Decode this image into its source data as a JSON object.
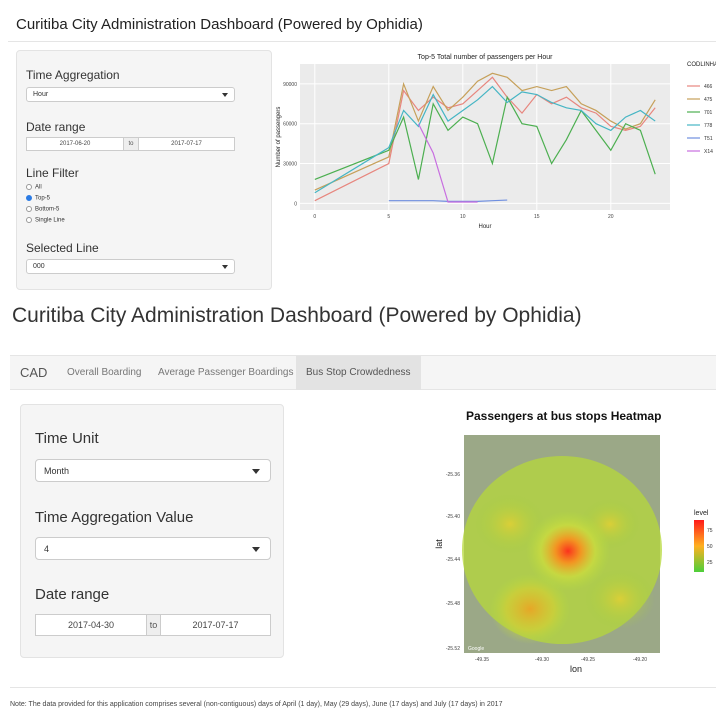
{
  "top_dashboard": {
    "title": "Curitiba City Administration Dashboard (Powered by Ophidia)",
    "time_aggregation": {
      "label": "Time Aggregation",
      "value": "Hour"
    },
    "date_range": {
      "label": "Date range",
      "start": "2017-06-20",
      "separator": "to",
      "end": "2017-07-17"
    },
    "line_filter": {
      "label": "Line Filter",
      "options": [
        "All",
        "Top-5",
        "Bottom-5",
        "Single Line"
      ],
      "selected": "Top-5"
    },
    "selected_line": {
      "label": "Selected Line",
      "value": "000"
    }
  },
  "chart_data": {
    "type": "line",
    "title": "Top-5 Total number of passengers per Hour",
    "xlabel": "Hour",
    "ylabel": "Number of passengers",
    "xlim": [
      -1,
      24
    ],
    "ylim": [
      -5000,
      105000
    ],
    "x_ticks": [
      0,
      5,
      10,
      15,
      20
    ],
    "y_ticks": [
      0,
      30000,
      60000,
      90000
    ],
    "y_tick_labels": [
      "0",
      "30000",
      "60000",
      "90000"
    ],
    "legend_title": "CODLINHA",
    "legend_position": "right",
    "background": "grey",
    "series": [
      {
        "name": "466",
        "color": "#e7867e",
        "x": [
          0,
          5,
          6,
          7,
          8,
          9,
          10,
          11,
          12,
          13,
          14,
          15,
          16,
          17,
          18,
          19,
          20,
          21,
          22,
          23
        ],
        "y": [
          2000,
          30000,
          85000,
          70000,
          80000,
          72000,
          75000,
          85000,
          95000,
          80000,
          68000,
          82000,
          75000,
          80000,
          72000,
          68000,
          58000,
          55000,
          58000,
          72000
        ]
      },
      {
        "name": "475",
        "color": "#c6a05a",
        "x": [
          0,
          5,
          6,
          7,
          8,
          9,
          10,
          11,
          12,
          13,
          14,
          15,
          16,
          17,
          18,
          19,
          20,
          21,
          22,
          23
        ],
        "y": [
          10000,
          35000,
          90000,
          62000,
          88000,
          70000,
          80000,
          92000,
          98000,
          95000,
          85000,
          88000,
          85000,
          88000,
          75000,
          70000,
          62000,
          56000,
          60000,
          78000
        ]
      },
      {
        "name": "701",
        "color": "#4caf50",
        "x": [
          0,
          5,
          6,
          7,
          8,
          9,
          10,
          11,
          12,
          13,
          14,
          15,
          16,
          17,
          18,
          19,
          20,
          21,
          22,
          23
        ],
        "y": [
          18000,
          40000,
          65000,
          18000,
          75000,
          55000,
          65000,
          60000,
          30000,
          80000,
          60000,
          58000,
          30000,
          48000,
          70000,
          55000,
          40000,
          60000,
          55000,
          22000
        ]
      },
      {
        "name": "778",
        "color": "#45b5c4",
        "x": [
          0,
          5,
          6,
          7,
          8,
          9,
          10,
          11,
          12,
          13,
          14,
          15,
          16,
          17,
          18,
          19,
          20,
          21,
          22,
          23
        ],
        "y": [
          8000,
          42000,
          70000,
          58000,
          82000,
          62000,
          70000,
          78000,
          88000,
          76000,
          84000,
          82000,
          76000,
          72000,
          70000,
          60000,
          55000,
          65000,
          70000,
          62000
        ]
      },
      {
        "name": "T51",
        "color": "#6f8fe0",
        "x": [
          5,
          6,
          7,
          8,
          9,
          10,
          11,
          12,
          13
        ],
        "y": [
          2000,
          2000,
          2000,
          2000,
          1500,
          1500,
          1500,
          2000,
          2500
        ]
      },
      {
        "name": "X14",
        "color": "#c86ee0",
        "x": [
          7,
          8,
          9,
          10,
          11
        ],
        "y": [
          60000,
          38000,
          1000,
          1000,
          1000
        ]
      }
    ]
  },
  "bottom_dashboard": {
    "title": "Curitiba City Administration Dashboard (Powered by Ophidia)",
    "tabs": [
      "CAD",
      "Overall Boarding",
      "Average Passenger Boardings",
      "Bus Stop Crowdedness"
    ],
    "active_tab": "Bus Stop Crowdedness",
    "time_unit": {
      "label": "Time Unit",
      "value": "Month"
    },
    "time_aggregation_value": {
      "label": "Time Aggregation Value",
      "value": "4"
    },
    "date_range": {
      "label": "Date range",
      "start": "2017-04-30",
      "separator": "to",
      "end": "2017-07-17"
    }
  },
  "heatmap": {
    "title": "Passengers at bus stops Heatmap",
    "xlabel": "lon",
    "ylabel": "lat",
    "x_tick_labels": [
      "-49.35",
      "-49.30",
      "-49.25",
      "-49.20"
    ],
    "y_tick_labels": [
      "-25.36",
      "-25.40",
      "-25.44",
      "-25.48",
      "-25.52"
    ],
    "legend_title": "level",
    "legend_labels": [
      "75",
      "50",
      "25"
    ],
    "attribution": "Google"
  },
  "note": "Note: The data provided for this application comprises several (non-contiguous) days of April (1 day), May (29 days), June (17 days) and July (17 days) in 2017"
}
